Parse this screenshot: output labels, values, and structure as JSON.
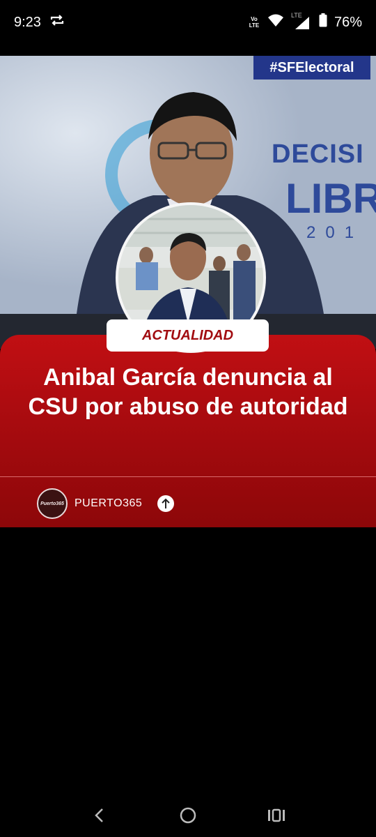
{
  "status_bar": {
    "time": "9:23",
    "volte": "Vo LTE",
    "lte": "LTE",
    "battery": "76%"
  },
  "post": {
    "photo_hashtag": "#SFElectoral",
    "photo_backdrop_text": "DECISI",
    "photo_backdrop_text2": "LIBR",
    "photo_backdrop_year": "201",
    "category_badge": "ACTUALIDAD",
    "headline": "Anibal García denuncia al CSU por abuso de autoridad",
    "author": {
      "avatar_text": "Puerto365",
      "name": "PUERTO365"
    }
  },
  "colors": {
    "card_red": "#b00c10",
    "badge_text": "#a10c10",
    "background": "#000000"
  },
  "icons": {
    "repeat": "repeat-icon",
    "wifi": "wifi-icon",
    "signal": "signal-icon",
    "battery": "battery-icon",
    "share": "arrow-up-icon",
    "back": "back-icon",
    "home": "home-icon",
    "recents": "recents-icon"
  }
}
